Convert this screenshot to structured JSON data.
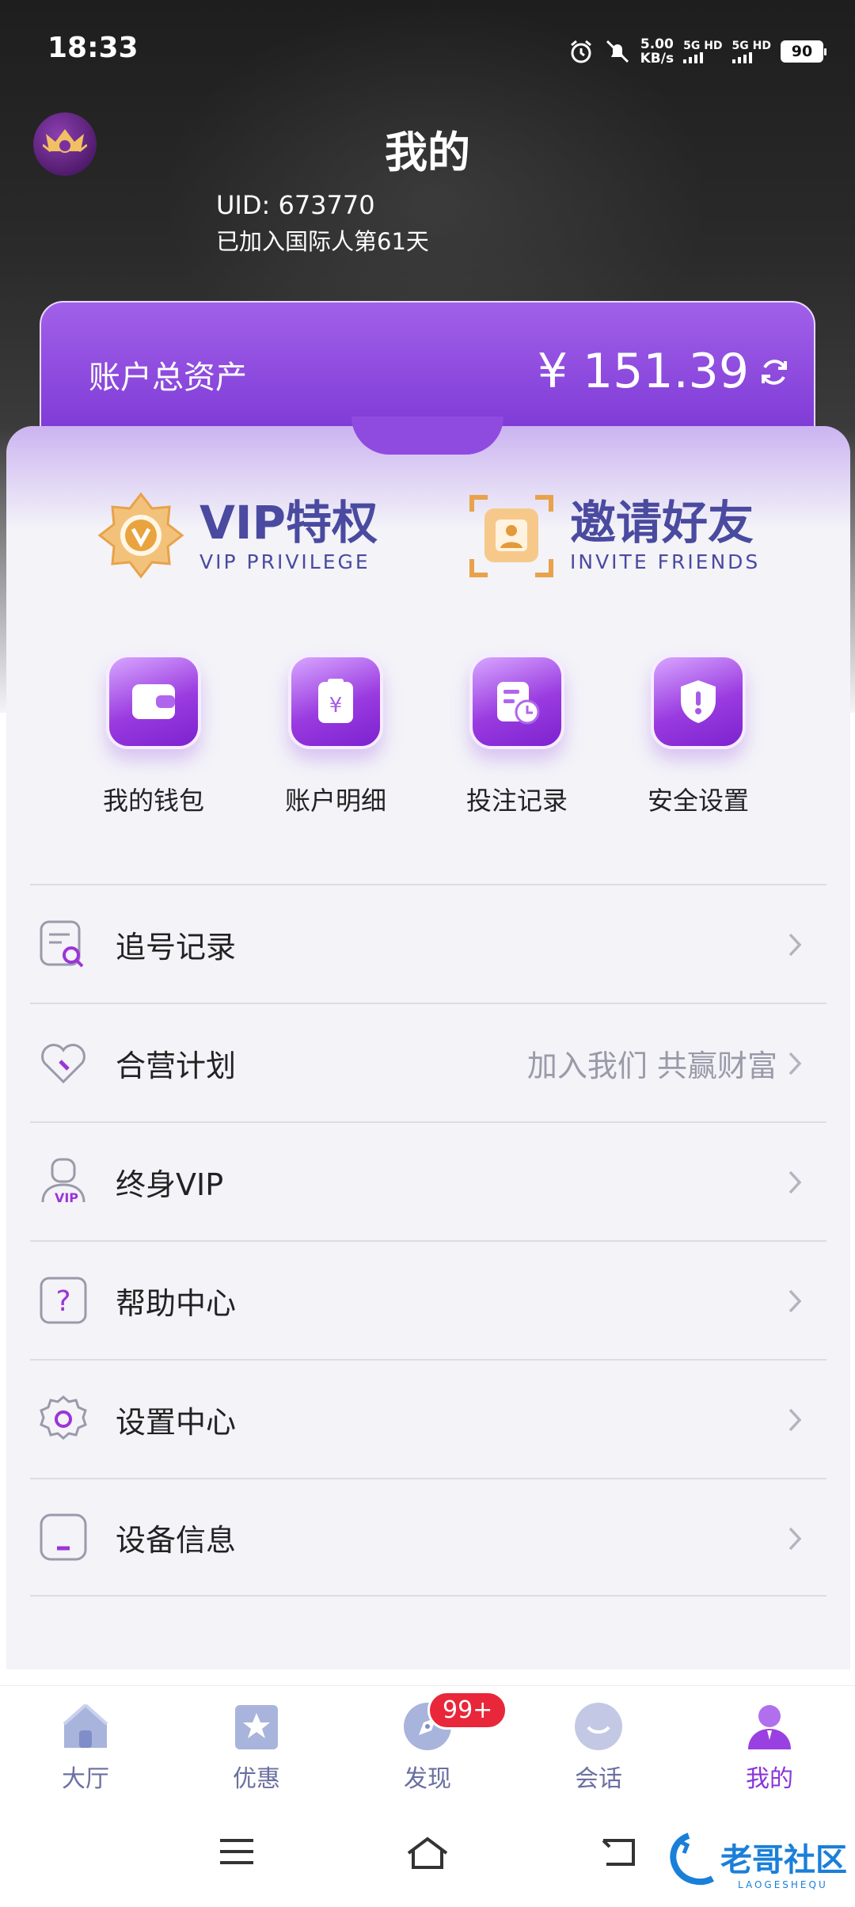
{
  "status": {
    "time": "18:33",
    "speed_value": "5.00",
    "speed_unit": "KB/s",
    "net1": "5G HD",
    "net2": "5G HD",
    "battery": "90"
  },
  "header": {
    "title": "我的"
  },
  "profile": {
    "uid": "UID: 673770",
    "joined": "已加入国际人第61天"
  },
  "assets": {
    "label": "账户总资产",
    "amount": "¥ 151.39"
  },
  "promos": [
    {
      "title": "VIP特权",
      "subtitle": "VIP PRIVILEGE"
    },
    {
      "title": "邀请好友",
      "subtitle": "INVITE FRIENDS"
    }
  ],
  "quick": [
    {
      "label": "我的钱包",
      "icon": "wallet-icon"
    },
    {
      "label": "账户明细",
      "icon": "receipt-icon"
    },
    {
      "label": "投注记录",
      "icon": "record-icon"
    },
    {
      "label": "安全设置",
      "icon": "shield-icon"
    }
  ],
  "menu": [
    {
      "label": "追号记录",
      "sub": "",
      "icon": "search-record-icon"
    },
    {
      "label": "合营计划",
      "sub": "加入我们 共赢财富",
      "icon": "heart-icon"
    },
    {
      "label": "终身VIP",
      "sub": "",
      "icon": "vip-user-icon"
    },
    {
      "label": "帮助中心",
      "sub": "",
      "icon": "help-icon"
    },
    {
      "label": "设置中心",
      "sub": "",
      "icon": "gear-icon"
    },
    {
      "label": "设备信息",
      "sub": "",
      "icon": "device-icon"
    }
  ],
  "tabs": [
    {
      "label": "大厅",
      "icon": "home-icon"
    },
    {
      "label": "优惠",
      "icon": "star-icon"
    },
    {
      "label": "发现",
      "icon": "compass-icon"
    },
    {
      "label": "会话",
      "icon": "chat-icon"
    },
    {
      "label": "我的",
      "icon": "user-icon"
    }
  ],
  "tab_badge": "99+",
  "watermark": {
    "text": "老哥社区",
    "sub": "LAOGESHEQU"
  },
  "colors": {
    "accent": "#8a35d8",
    "purple_card": "#8f4be0",
    "badge_red": "#e8273a"
  }
}
